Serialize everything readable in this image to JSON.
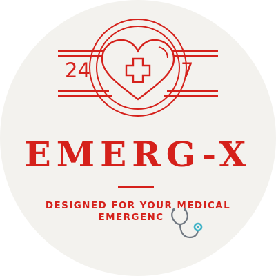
{
  "badge": {
    "left_number": "24",
    "right_number": "7",
    "brand_name": "EMERG-X",
    "tagline_line1": "DESIGNED FOR YOUR MEDICAL",
    "tagline_line2": "EMERGENC"
  },
  "colors": {
    "accent": "#d5211b",
    "background": "#f3f2ee",
    "stethoscope": "#6f7780",
    "stethoscope_tip": "#3fb3c7"
  },
  "icons": [
    "heart-cross-icon",
    "stethoscope-icon"
  ]
}
